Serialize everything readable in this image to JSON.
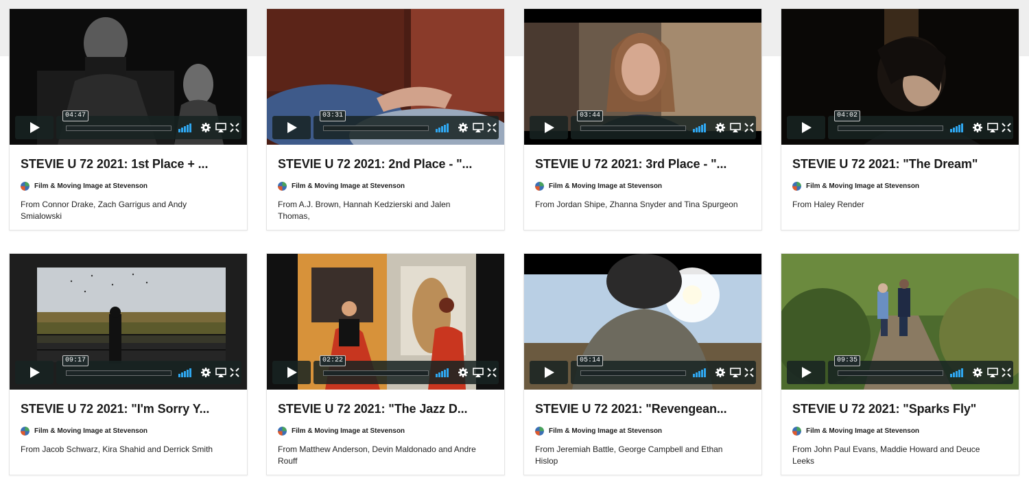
{
  "colors": {
    "accent": "#2fa7f0",
    "controls_bg": "#172322"
  },
  "icons": [
    "play-icon",
    "volume-icon",
    "settings-gear-icon",
    "airplay-icon",
    "fullscreen-icon"
  ],
  "videos": [
    {
      "title": "STEVIE U 72 2021: 1st Place + ...",
      "channel": "Film & Moving Image at Stevenson",
      "description": "From Connor Drake, Zach Garrigus and Andy Smialowski",
      "duration": "04:47"
    },
    {
      "title": "STEVIE U 72 2021: 2nd Place - \"...",
      "channel": "Film & Moving Image at Stevenson",
      "description": "From A.J. Brown, Hannah Kedzierski and Jalen Thomas,",
      "duration": "03:31"
    },
    {
      "title": "STEVIE U 72 2021: 3rd Place - \"...",
      "channel": "Film & Moving Image at Stevenson",
      "description": "From Jordan Shipe, Zhanna Snyder and Tina Spurgeon",
      "duration": "03:44"
    },
    {
      "title": "STEVIE U 72 2021: \"The Dream\"",
      "channel": "Film & Moving Image at Stevenson",
      "description": "From Haley Render",
      "duration": "04:02"
    },
    {
      "title": "STEVIE U 72 2021: \"I'm Sorry Y...",
      "channel": "Film & Moving Image at Stevenson",
      "description": "From Jacob Schwarz, Kira Shahid and Derrick Smith",
      "duration": "09:17"
    },
    {
      "title": "STEVIE U 72 2021: \"The Jazz D...",
      "channel": "Film & Moving Image at Stevenson",
      "description": "From Matthew Anderson, Devin Maldonado and Andre Rouff",
      "duration": "02:22"
    },
    {
      "title": "STEVIE U 72 2021: \"Revengean...",
      "channel": "Film & Moving Image at Stevenson",
      "description": "From Jeremiah Battle, George Campbell and Ethan Hislop",
      "duration": "05:14"
    },
    {
      "title": "STEVIE U 72 2021: \"Sparks Fly\"",
      "channel": "Film & Moving Image at Stevenson",
      "description": "From John Paul Evans, Maddie Howard and Deuce Leeks",
      "duration": "09:35"
    }
  ]
}
